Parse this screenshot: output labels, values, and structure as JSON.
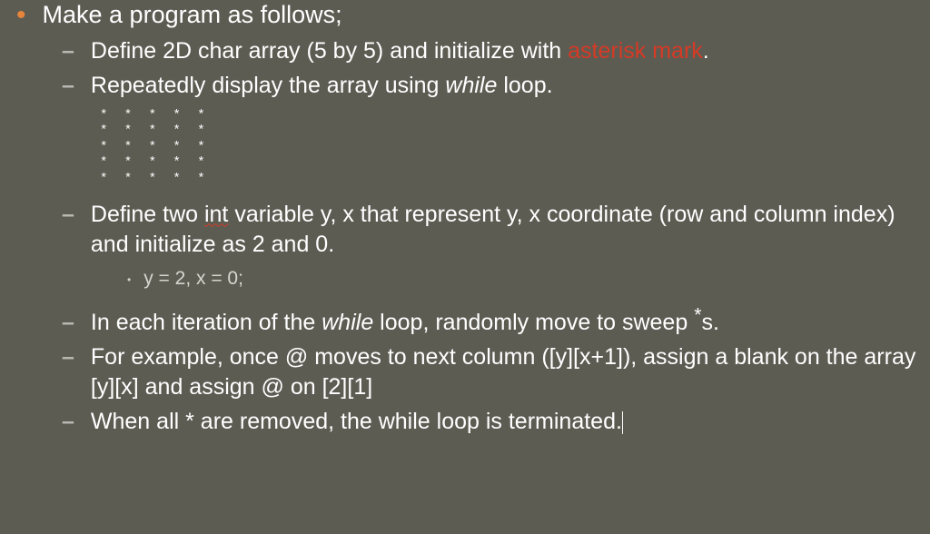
{
  "bullet_main": {
    "text": "Make a program as follows;"
  },
  "sub1": {
    "prefix": "Define 2D char array (5 by 5) and initialize with ",
    "highlight": "asterisk mark",
    "suffix": "."
  },
  "sub2": {
    "prefix": "Repeatedly display the array using ",
    "italic": "while",
    "suffix": " loop."
  },
  "grid": {
    "rows": [
      "* * * * *",
      "* * * * *",
      "* * * * *",
      "* * * * *",
      "* * * * *"
    ]
  },
  "sub3": {
    "prefix": "Define two ",
    "squiggly": "int",
    "suffix": " variable y, x that represent y, x coordinate (row and column index) and initialize as 2 and 0."
  },
  "sub3_detail": "y = 2, x = 0;",
  "sub4": {
    "prefix": "In each iteration of the ",
    "italic": "while",
    "mid": " loop, randomly move to sweep ",
    "star": "*",
    "suffix": "s."
  },
  "sub5": "For example, once @ moves to next column ([y][x+1]), assign a blank on the array [y][x] and assign @ on [2][1]",
  "sub6": "When all * are removed, the while loop is terminated."
}
